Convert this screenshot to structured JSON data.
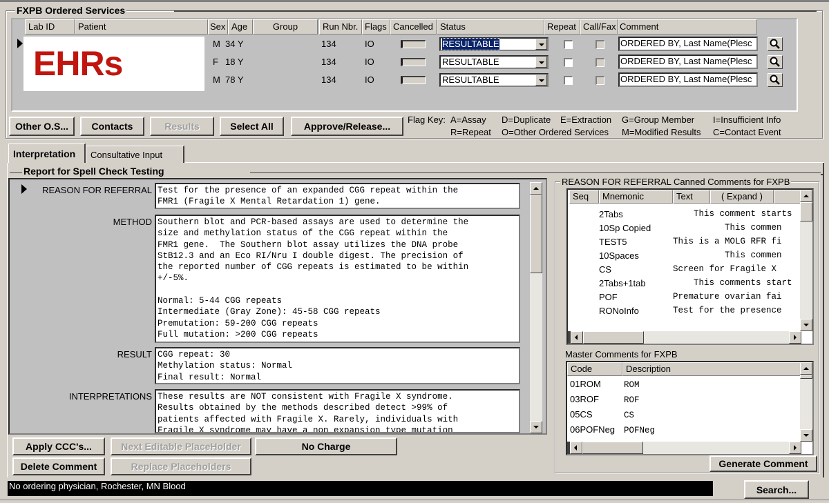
{
  "ordered_services": {
    "title": "FXPB Ordered Services",
    "columns": [
      "Lab ID",
      "Patient",
      "Sex",
      "Age",
      "Group",
      "Run Nbr.",
      "Flags",
      "Cancelled",
      "Status",
      "Repeat",
      "Call/Fax",
      "Comment"
    ],
    "redaction_label": "EHRs",
    "redaction_color": "#c0160f",
    "rows": [
      {
        "sex": "M",
        "age": "34 Y",
        "group": "",
        "run_nbr": "134",
        "flags": "IO",
        "status": "RESULTABLE",
        "status_selected": true,
        "repeat": false,
        "call_fax": false,
        "comment": "ORDERED BY, Last Name(Plesc"
      },
      {
        "sex": "F",
        "age": "18 Y",
        "group": "",
        "run_nbr": "134",
        "flags": "IO",
        "status": "RESULTABLE",
        "status_selected": false,
        "repeat": false,
        "call_fax": false,
        "comment": "ORDERED BY, Last Name(Plesc"
      },
      {
        "sex": "M",
        "age": "78 Y",
        "group": "",
        "run_nbr": "134",
        "flags": "IO",
        "status": "RESULTABLE",
        "status_selected": false,
        "repeat": false,
        "call_fax": false,
        "comment": "ORDERED BY, Last Name(Plesc"
      }
    ]
  },
  "toolbar": {
    "other_os": "Other O.S...",
    "contacts": "Contacts",
    "results": "Results",
    "select_all": "Select All",
    "approve_release": "Approve/Release..."
  },
  "flag_key": {
    "label": "Flag Key:",
    "row1": [
      "A=Assay",
      "D=Duplicate",
      "E=Extraction",
      "G=Group Member",
      "I=Insufficient Info"
    ],
    "row2": [
      "R=Repeat",
      "O=Other Ordered Services",
      "M=Modified Results",
      "C=Contact Event"
    ]
  },
  "tabs": [
    {
      "label": "Interpretation",
      "active": true
    },
    {
      "label": "Consultative Input",
      "active": false
    }
  ],
  "report": {
    "title": "Report for Spell Check Testing",
    "sections": [
      {
        "label": "REASON FOR REFERRAL",
        "text": "Test for the presence of an expanded CGG repeat within the\nFMR1 (Fragile X Mental Retardation 1) gene."
      },
      {
        "label": "METHOD",
        "text": "Southern blot and PCR-based assays are used to determine the\nsize and methylation status of the CGG repeat within the\nFMR1 gene.  The Southern blot assay utilizes the DNA probe\nStB12.3 and an Eco RI/Nru I double digest. The precision of\nthe reported number of CGG repeats is estimated to be within\n+/-5%.\n\nNormal: 5-44 CGG repeats\nIntermediate (Gray Zone): 45-58 CGG repeats\nPremutation: 59-200 CGG repeats\nFull mutation: >200 CGG repeats"
      },
      {
        "label": "RESULT",
        "text": "CGG repeat: 30\nMethylation status: Normal\nFinal result: Normal"
      },
      {
        "label": "INTERPRETATIONS",
        "text": "These results are NOT consistent with Fragile X syndrome.\nResults obtained by the methods described detect >99% of\npatients affected with Fragile X. Rarely, individuals with\nFragile X syndrome may have a non expansion type mutation"
      }
    ]
  },
  "bottom_buttons": {
    "apply_ccc": "Apply CCC's...",
    "next_placeholder": "Next Editable PlaceHolder",
    "no_charge": "No Charge",
    "delete_comment": "Delete Comment",
    "replace_placeholders": "Replace Placeholders"
  },
  "canned_comments": {
    "title": "REASON FOR REFERRAL Canned Comments for FXPB",
    "columns": [
      "Seq",
      "Mnemonic",
      "Text"
    ],
    "expand_label": "( Expand )",
    "rows": [
      {
        "seq": "",
        "mnemonic": "2Tabs",
        "text": "    This comment starts"
      },
      {
        "seq": "",
        "mnemonic": "10Sp Copied",
        "text": "          This commen"
      },
      {
        "seq": "",
        "mnemonic": "TEST5",
        "text": "This is a MOLG RFR fi"
      },
      {
        "seq": "",
        "mnemonic": "10Spaces",
        "text": "          This commen"
      },
      {
        "seq": "",
        "mnemonic": "CS",
        "text": "Screen for Fragile X"
      },
      {
        "seq": "",
        "mnemonic": "2Tabs+1tab",
        "text": "    This comments start"
      },
      {
        "seq": "",
        "mnemonic": "POF",
        "text": "Premature ovarian fai"
      },
      {
        "seq": "",
        "mnemonic": "RONoInfo",
        "text": "Test for the presence"
      }
    ]
  },
  "master_comments": {
    "title": "Master Comments for FXPB",
    "columns": [
      "Code",
      "Description"
    ],
    "rows": [
      {
        "code": "01ROM",
        "description": "ROM"
      },
      {
        "code": "03ROF",
        "description": "ROF"
      },
      {
        "code": "05CS",
        "description": "CS"
      },
      {
        "code": "06POFNeg",
        "description": "POFNeg"
      }
    ],
    "generate_label": "Generate Comment"
  },
  "status_bar": {
    "text": "No ordering physician, Rochester, MN  Blood",
    "search_label": "Search..."
  }
}
